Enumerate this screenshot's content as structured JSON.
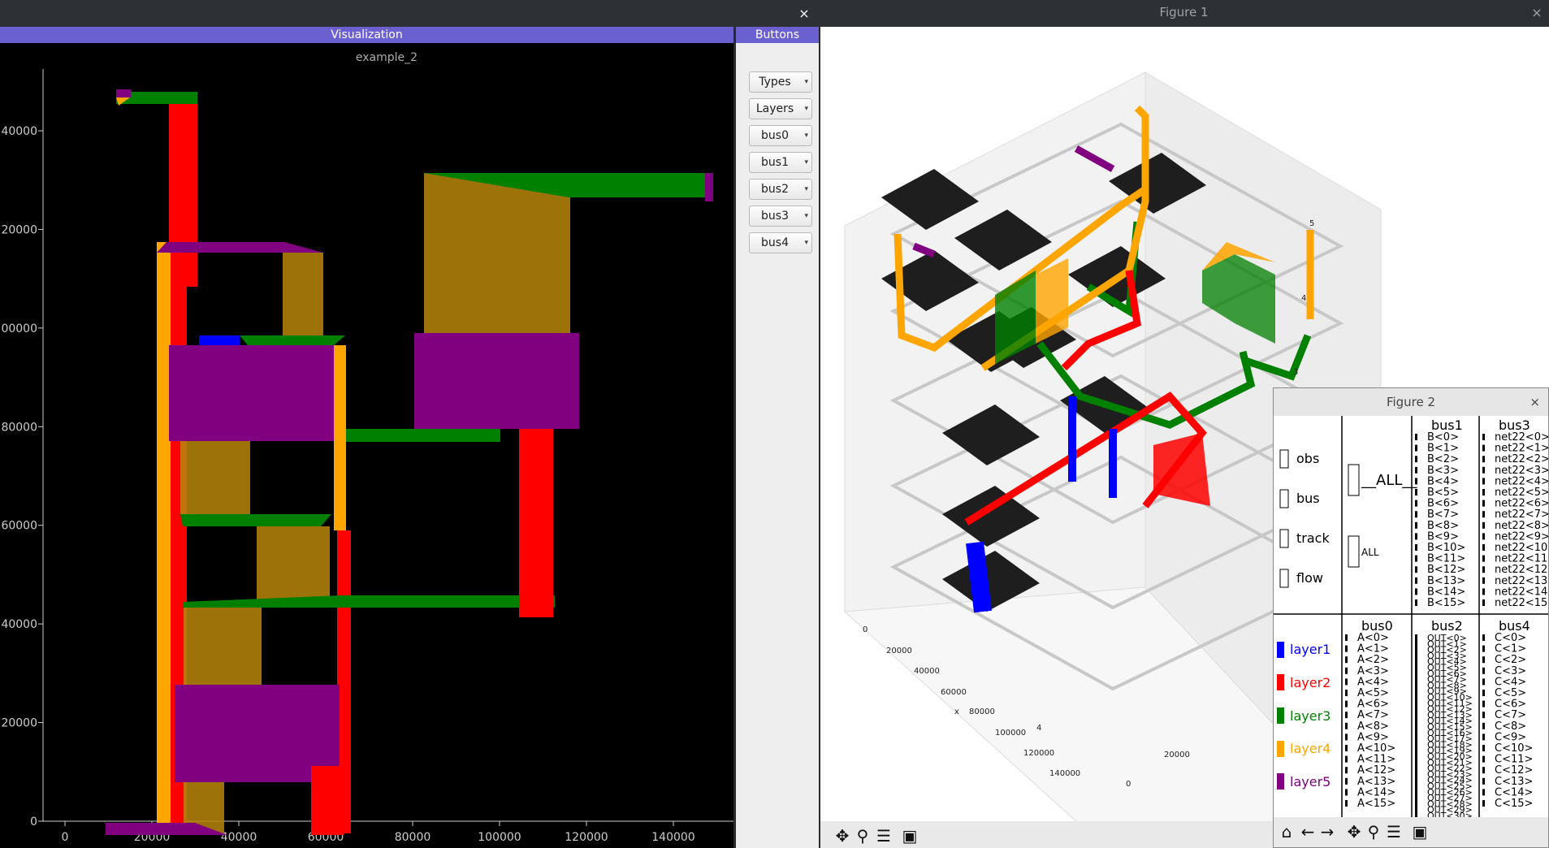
{
  "left_window": {
    "close_glyph": "×",
    "vis_header": "Visualization",
    "plot_title": "example_2",
    "y_ticks": [
      {
        "label": "0",
        "v": 0
      },
      {
        "label": "20000",
        "v": 20000
      },
      {
        "label": "40000",
        "v": 40000
      },
      {
        "label": "60000",
        "v": 60000
      },
      {
        "label": "80000",
        "v": 80000
      },
      {
        "label": "00000",
        "v": 100000
      },
      {
        "label": "20000",
        "v": 120000
      },
      {
        "label": "40000",
        "v": 140000
      }
    ],
    "x_ticks": [
      "0",
      "20000",
      "40000",
      "60000",
      "80000",
      "100000",
      "120000",
      "140000"
    ],
    "buttons_header": "Buttons",
    "combos": [
      "Types",
      "Layers",
      "bus0",
      "bus1",
      "bus2",
      "bus3",
      "bus4"
    ]
  },
  "figure1": {
    "title": "Figure 1",
    "close_glyph": "×",
    "x_axis_label": "x",
    "x_ticks": [
      "0",
      "20000",
      "40000",
      "60000",
      "80000",
      "100000",
      "120000",
      "140000"
    ],
    "y_ticks": [
      "0",
      "20000"
    ],
    "z_ticks": [
      "3",
      "4",
      "5"
    ],
    "y_partial_tick": "4"
  },
  "figure2": {
    "title": "Figure 2",
    "close_glyph": "×",
    "types": [
      "obs",
      "bus",
      "track",
      "flow"
    ],
    "all_labels": [
      "__ALL__",
      "ALL"
    ],
    "layers": [
      {
        "name": "layer1",
        "color": "#0000ff"
      },
      {
        "name": "layer2",
        "color": "#ff0000"
      },
      {
        "name": "layer3",
        "color": "#008000"
      },
      {
        "name": "layer4",
        "color": "#ffa500"
      },
      {
        "name": "layer5",
        "color": "#800080"
      }
    ],
    "bus1": {
      "title": "bus1",
      "items": [
        "B<0>",
        "B<1>",
        "B<2>",
        "B<3>",
        "B<4>",
        "B<5>",
        "B<6>",
        "B<7>",
        "B<8>",
        "B<9>",
        "B<10>",
        "B<11>",
        "B<12>",
        "B<13>",
        "B<14>",
        "B<15>"
      ]
    },
    "bus3": {
      "title": "bus3",
      "items": [
        "net22<0>",
        "net22<1>",
        "net22<2>",
        "net22<3>",
        "net22<4>",
        "net22<5>",
        "net22<6>",
        "net22<7>",
        "net22<8>",
        "net22<9>",
        "net22<10>",
        "net22<11>",
        "net22<12>",
        "net22<13>",
        "net22<14>",
        "net22<15>"
      ]
    },
    "bus0": {
      "title": "bus0",
      "items": [
        "A<0>",
        "A<1>",
        "A<2>",
        "A<3>",
        "A<4>",
        "A<5>",
        "A<6>",
        "A<7>",
        "A<8>",
        "A<9>",
        "A<10>",
        "A<11>",
        "A<12>",
        "A<13>",
        "A<14>",
        "A<15>"
      ]
    },
    "bus2": {
      "title": "bus2",
      "items": [
        "OUT<0>",
        "OUT<1>",
        "OUT<2>",
        "OUT<3>",
        "OUT<4>",
        "OUT<5>",
        "OUT<6>",
        "OUT<7>",
        "OUT<8>",
        "OUT<9>",
        "OUT<10>",
        "OUT<11>",
        "OUT<12>",
        "OUT<13>",
        "OUT<14>",
        "OUT<15>",
        "OUT<16>",
        "OUT<17>",
        "OUT<18>",
        "OUT<19>",
        "OUT<20>",
        "OUT<21>",
        "OUT<22>",
        "OUT<23>",
        "OUT<24>",
        "OUT<25>",
        "OUT<26>",
        "OUT<27>",
        "OUT<28>",
        "OUT<29>",
        "OUT<30>",
        "OUT<31>"
      ]
    },
    "bus4": {
      "title": "bus4",
      "items": [
        "C<0>",
        "C<1>",
        "C<2>",
        "C<3>",
        "C<4>",
        "C<5>",
        "C<6>",
        "C<7>",
        "C<8>",
        "C<9>",
        "C<10>",
        "C<11>",
        "C<12>",
        "C<13>",
        "C<14>",
        "C<15>"
      ]
    }
  },
  "toolbar_icons": {
    "fig1": [
      "move-icon",
      "zoom-icon",
      "configure-icon",
      "save-icon"
    ],
    "fig2": [
      "home-icon",
      "back-icon",
      "forward-icon",
      "move-icon",
      "zoom-icon",
      "configure-icon",
      "save-icon"
    ]
  }
}
